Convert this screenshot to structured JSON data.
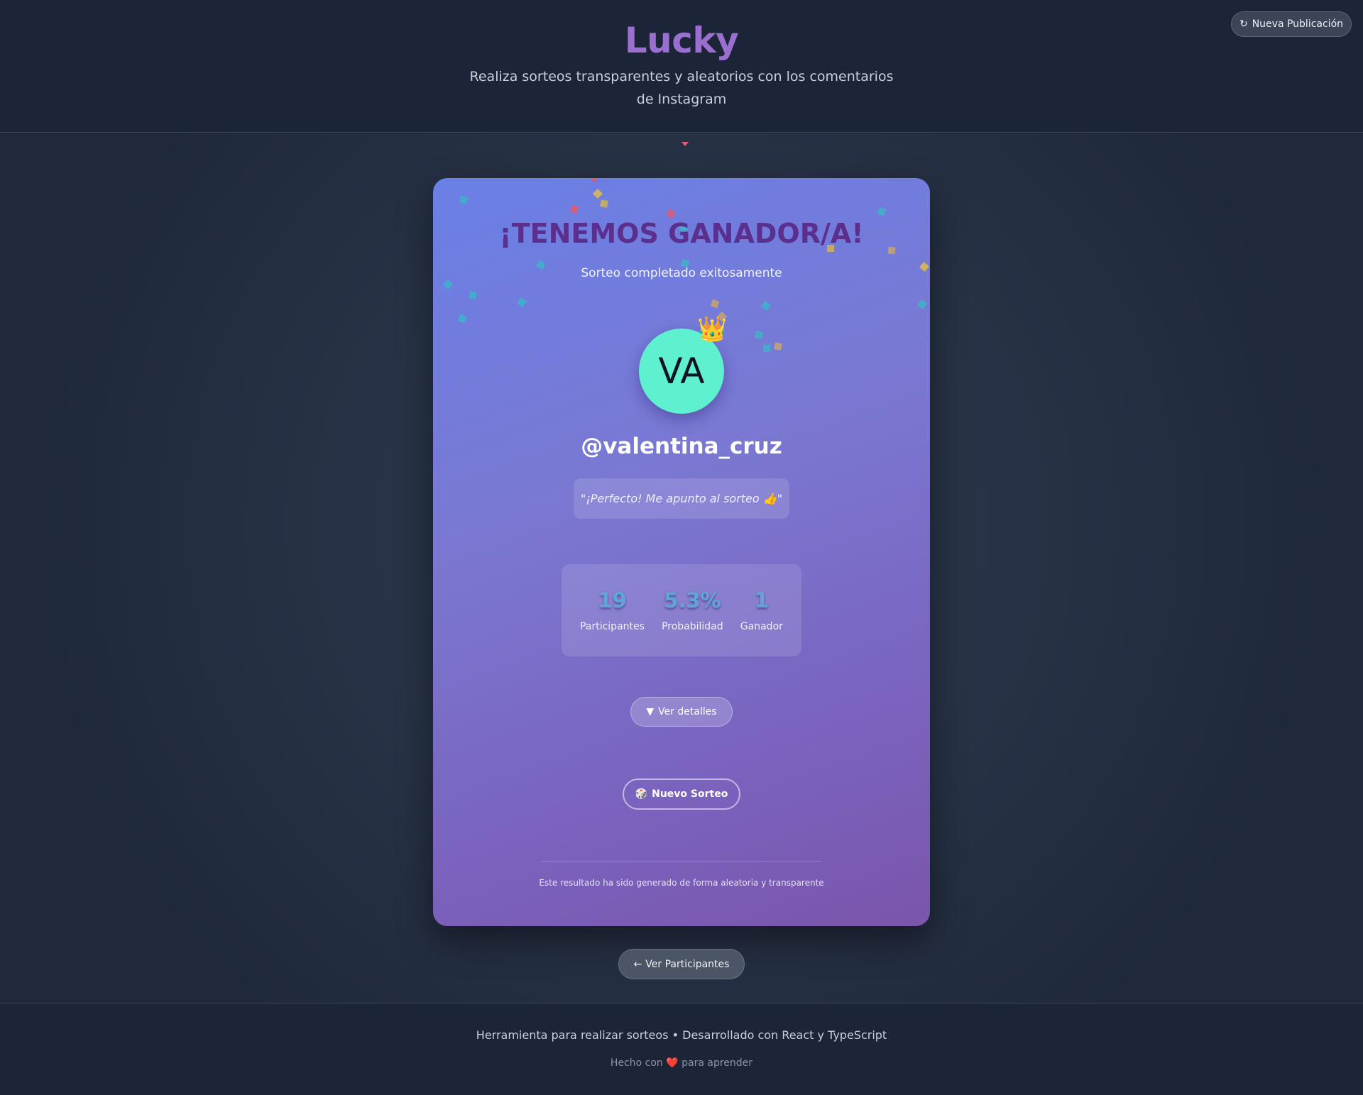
{
  "header": {
    "brand": "Lucky",
    "tagline": "Realiza sorteos transparentes y aleatorios con los comentarios de Instagram",
    "new_pub_icon": "↻",
    "new_pub_label": "Nueva Publicación"
  },
  "card": {
    "title": "¡TENEMOS GANADOR/A!",
    "subtitle": "Sorteo completado exitosamente",
    "avatar_initials": "VA",
    "crown": "👑",
    "username": "@valentina_cruz",
    "comment": "\"¡Perfecto! Me apunto al sorteo 👍\"",
    "stats": [
      {
        "value": "19",
        "label": "Participantes"
      },
      {
        "value": "5.3%",
        "label": "Probabilidad"
      },
      {
        "value": "1",
        "label": "Ganador"
      }
    ],
    "details_icon": "▼",
    "details_label": "Ver detalles",
    "draw_icon": "🎲",
    "draw_label": "Nuevo Sorteo",
    "note": "Este resultado ha sido generado de forma aleatoria y transparente"
  },
  "participants_button": {
    "icon": "←",
    "label": "Ver Participantes"
  },
  "footer": {
    "line1": "Herramienta para realizar sorteos • Desarrollado con React y TypeScript",
    "line2_prefix": "Hecho con",
    "heart": "❤️",
    "line2_suffix": "para aprender"
  },
  "colors": {
    "brand": "#9b6fd0",
    "background": "#1c2537",
    "card_gradient_start": "#6a80e6",
    "card_gradient_end": "#7b55ab",
    "title": "#5a2f8e",
    "avatar": "#5ff0d0",
    "stat_value": "#5fa6d6"
  }
}
